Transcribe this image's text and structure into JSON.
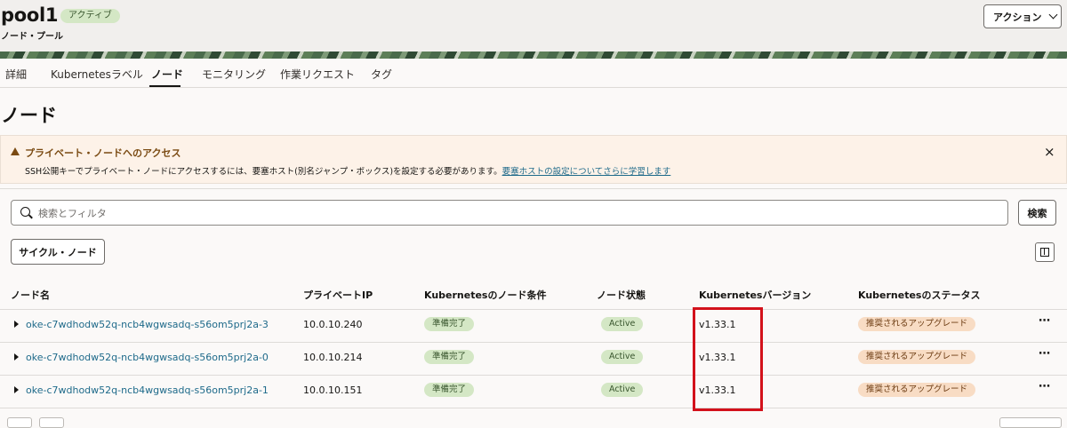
{
  "header": {
    "title": "pool1",
    "status_badge": "アクティブ",
    "subtitle": "ノード・プール",
    "action_label": "アクション"
  },
  "tabs": [
    {
      "label": "詳細"
    },
    {
      "label": "Kubernetesラベル"
    },
    {
      "label": "ノード"
    },
    {
      "label": "モニタリング"
    },
    {
      "label": "作業リクエスト"
    },
    {
      "label": "タグ"
    }
  ],
  "selected_tab": "ノード",
  "page_title": "ノード",
  "alert": {
    "title": "プライベート・ノードへのアクセス",
    "body": "SSH公開キーでプライベート・ノードにアクセスするには、要塞ホスト(別名ジャンプ・ボックス)を設定する必要があります。",
    "link": "要塞ホストの設定についてさらに学習します",
    "close_glyph": "×"
  },
  "search": {
    "placeholder": "検索とフィルタ",
    "value": "",
    "button_label": "検索"
  },
  "cycle_button_label": "サイクル・ノード",
  "table": {
    "columns": [
      "ノード名",
      "プライベートIP",
      "Kubernetesのノード条件",
      "ノード状態",
      "Kubernetesバージョン",
      "Kubernetesのステータス"
    ],
    "rows": [
      {
        "name": "oke-c7wdhodw52q-ncb4wgwsadq-s56om5prj2a-3",
        "ip": "10.0.10.240",
        "condition": "準備完了",
        "state": "Active",
        "version": "v1.33.1",
        "status": "推奨されるアップグレード",
        "more": "⋯"
      },
      {
        "name": "oke-c7wdhodw52q-ncb4wgwsadq-s56om5prj2a-0",
        "ip": "10.0.10.214",
        "condition": "準備完了",
        "state": "Active",
        "version": "v1.33.1",
        "status": "推奨されるアップグレード",
        "more": "⋯"
      },
      {
        "name": "oke-c7wdhodw52q-ncb4wgwsadq-s56om5prj2a-1",
        "ip": "10.0.10.151",
        "condition": "準備完了",
        "state": "Active",
        "version": "v1.33.1",
        "status": "推奨されるアップグレード",
        "more": "⋯"
      }
    ]
  },
  "colors": {
    "active_badge_bg": "#d4e7c5",
    "upgrade_badge_bg": "#f8dcc4",
    "link": "#1e6a8a",
    "highlight_box": "#d3111b",
    "alert_bg": "#fdf2e8"
  },
  "icons": [
    "chevron-down-icon",
    "warning-icon",
    "close-icon",
    "search-icon",
    "columns-icon",
    "expand-caret-icon",
    "more-actions-icon"
  ]
}
